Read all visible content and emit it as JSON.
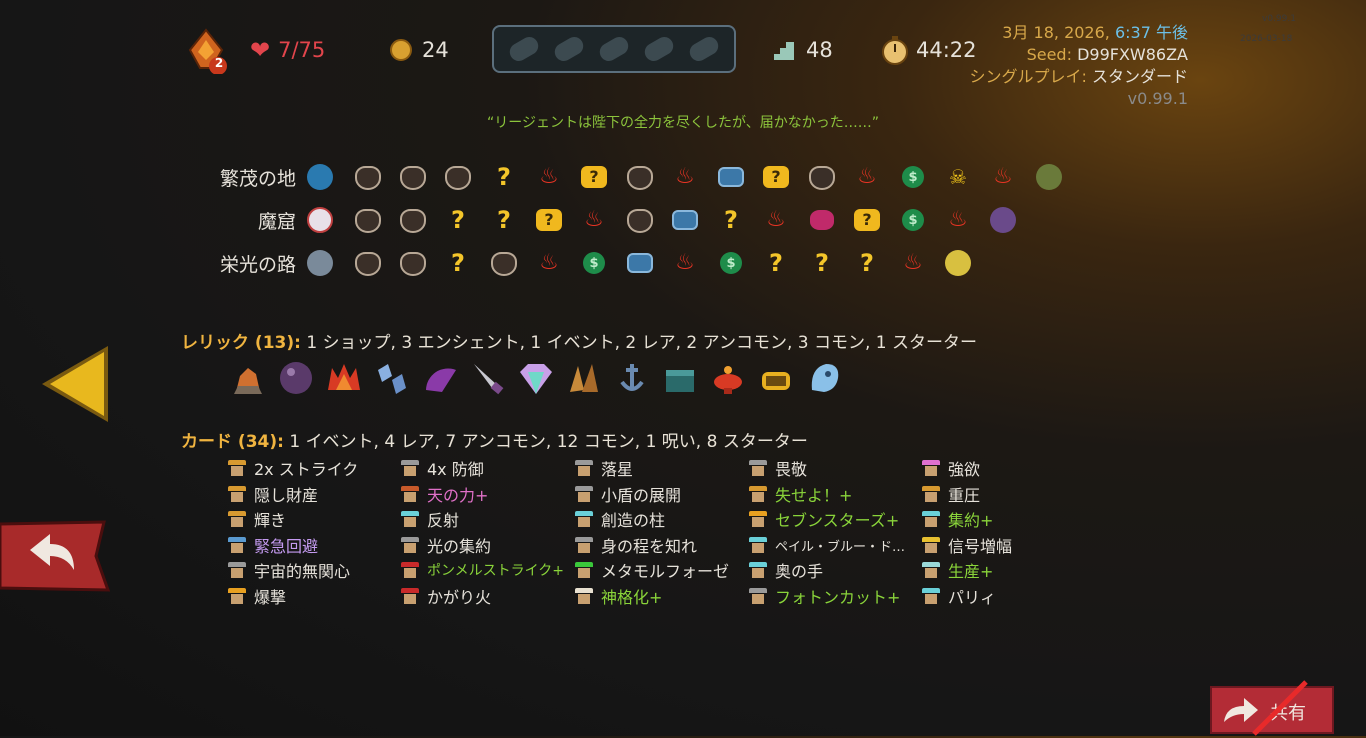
{
  "header": {
    "ascension_level": "2",
    "hp": "7/75",
    "gold": "24",
    "floor": "48",
    "time": "44:22",
    "date_prefix": "3月 18, 2026, ",
    "date_time": "6:37 午後",
    "seed_label": "Seed: ",
    "seed": "D99FXW86ZA",
    "mode_label": "シングルプレイ: ",
    "mode": "スタンダード",
    "version": "v0.99.1",
    "ghost_version": "v0.99.1",
    "ghost_date": "2026-03-18"
  },
  "quote": "“リージェントは陛下の全力を尽くしたが、届かなかった……”",
  "acts": [
    {
      "label": "繁茂の地"
    },
    {
      "label": "魔窟"
    },
    {
      "label": "栄光の路"
    }
  ],
  "relics": {
    "title": "レリック (13):",
    "summary": " 1 ショップ, 3 エンシェント, 1 イベント, 2 レア, 2 アンコモン, 3 コモン, 1 スターター"
  },
  "cards": {
    "title": "カード (34):",
    "summary": " 1 イベント, 4 レア, 7 アンコモン, 12 コモン, 1 呪い, 8 スターター",
    "columns": [
      [
        "2x ストライク",
        "隠し財産",
        "輝き",
        "緊急回避",
        "宇宙的無関心",
        "爆撃"
      ],
      [
        "4x 防御",
        "天の力+",
        "反射",
        "光の集約",
        "ポンメルストライク+",
        "かがり火"
      ],
      [
        "落星",
        "小盾の展開",
        "創造の柱",
        "身の程を知れ",
        "メタモルフォーゼ",
        "神格化+"
      ],
      [
        "畏敬",
        "失せよ！+",
        "セブンスターズ+",
        "ペイル・ブルー・ド…",
        "奥の手",
        "フォトンカット+"
      ],
      [
        "強欲",
        "重圧",
        "集約+",
        "信号増幅",
        "生産+",
        "パリィ"
      ]
    ]
  },
  "share_button": "共有",
  "colors": {
    "hp": "#e2454c",
    "accent_gold": "#f0b440",
    "upgraded_green": "#8ad43a",
    "rare_pink": "#e070c8",
    "event_purple": "#c49af0",
    "share_red": "#b32c36"
  }
}
